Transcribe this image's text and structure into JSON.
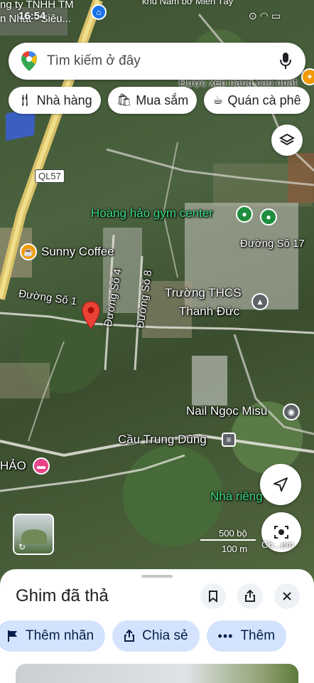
{
  "status_bar": {
    "line1": "ng ty TNHH TM",
    "time": "16:54",
    "line2": "n Nhất - Siêu...",
    "top_right": "khu Nam bơ Miến Tây"
  },
  "search": {
    "placeholder": "Tìm kiếm ở đây"
  },
  "chips": [
    {
      "label": "Nhà hàng",
      "icon": "fork-knife-icon"
    },
    {
      "label": "Mua sắm",
      "icon": "shopping-bag-icon"
    },
    {
      "label": "Quán cà phê",
      "icon": "coffee-cup-icon"
    }
  ],
  "map_labels": {
    "rated": "Được xếp hạng cao nhất",
    "highway": "QL57",
    "gym": "Hoàng hảo gym center",
    "road17": "Đường Số 17",
    "coffee": "Sunny Coffee",
    "road1": "Đường Số 1",
    "road4": "Đường Số 4",
    "road8": "Đường Số 8",
    "school_l1": "Trường THCS",
    "school_l2": "Thanh Đức",
    "nail": "Nail Ngọc Misu",
    "bridge": "Cầu Trung Dũng",
    "hotel": "HẢO",
    "private": "Nhà riêng",
    "scale_ft": "500 bộ",
    "scale_m": "100 m",
    "lens_label": "Ch...em"
  },
  "sheet": {
    "title": "Ghim đã thả",
    "actions": [
      {
        "label": "Thêm nhãn",
        "icon": "flag-icon"
      },
      {
        "label": "Chia sẻ",
        "icon": "share-icon"
      },
      {
        "label": "Thêm",
        "icon": "more-dots-icon"
      }
    ]
  },
  "colors": {
    "accent_blue": "#1a73e8",
    "chip_bg": "#d3e3fd",
    "pin_red": "#ea4335",
    "poi_green": "#1e8e3e",
    "poi_pink": "#e84387",
    "poi_orange": "#f29900"
  }
}
